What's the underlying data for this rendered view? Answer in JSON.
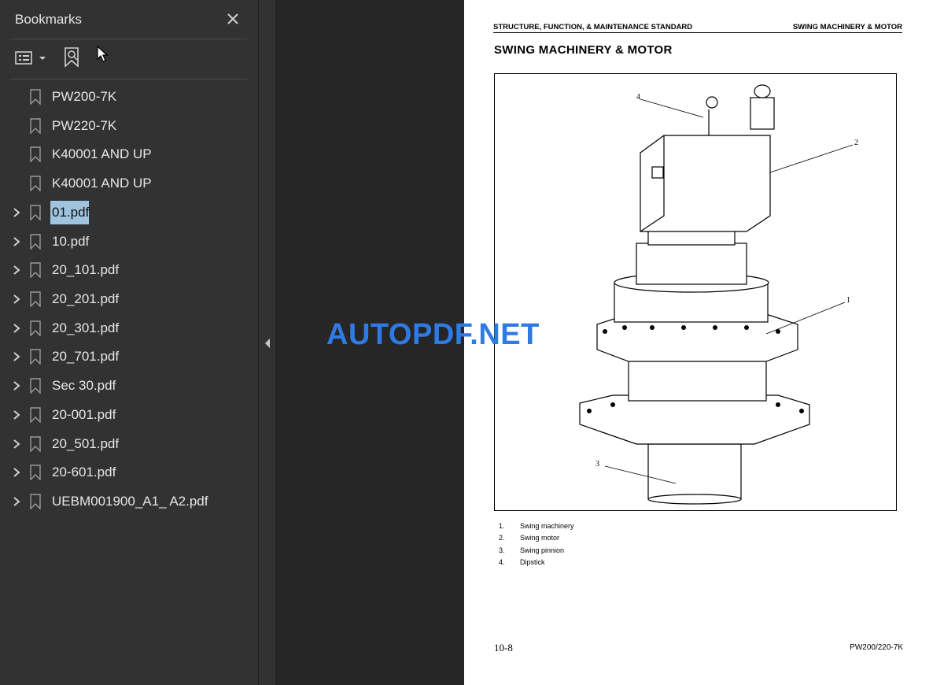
{
  "sidebar": {
    "title": "Bookmarks",
    "items": [
      {
        "label": "PW200-7K",
        "expandable": false
      },
      {
        "label": "PW220-7K",
        "expandable": false
      },
      {
        "label": "K40001 AND UP",
        "expandable": false
      },
      {
        "label": "K40001 AND UP",
        "expandable": false
      },
      {
        "label": "01.pdf",
        "expandable": true,
        "selected": true
      },
      {
        "label": "10.pdf",
        "expandable": true
      },
      {
        "label": "20_101.pdf",
        "expandable": true
      },
      {
        "label": "20_201.pdf",
        "expandable": true
      },
      {
        "label": "20_301.pdf",
        "expandable": true
      },
      {
        "label": "20_701.pdf",
        "expandable": true
      },
      {
        "label": "Sec 30.pdf",
        "expandable": true
      },
      {
        "label": "20-001.pdf",
        "expandable": true
      },
      {
        "label": "20_501.pdf",
        "expandable": true
      },
      {
        "label": "20-601.pdf",
        "expandable": true
      },
      {
        "label": "UEBM001900_A1_ A2.pdf",
        "expandable": true
      }
    ]
  },
  "page": {
    "header_left": "STRUCTURE, FUNCTION, & MAINTENANCE STANDARD",
    "header_right": "SWING MACHINERY & MOTOR",
    "heading": "SWING MACHINERY & MOTOR",
    "callouts": [
      "1",
      "2",
      "3",
      "4"
    ],
    "legend": [
      {
        "num": "1.",
        "text": "Swing machinery"
      },
      {
        "num": "2.",
        "text": "Swing motor"
      },
      {
        "num": "3.",
        "text": "Swing pinnion"
      },
      {
        "num": "4.",
        "text": "Dipstick"
      }
    ],
    "footer_left": "10-8",
    "footer_right": "PW200/220-7K"
  },
  "watermark": "AUTOPDF.NET",
  "colors": {
    "sidebar_bg": "#323232",
    "viewer_bg": "#262626",
    "selection": "#9fc4df",
    "watermark": "#2e7be6"
  }
}
